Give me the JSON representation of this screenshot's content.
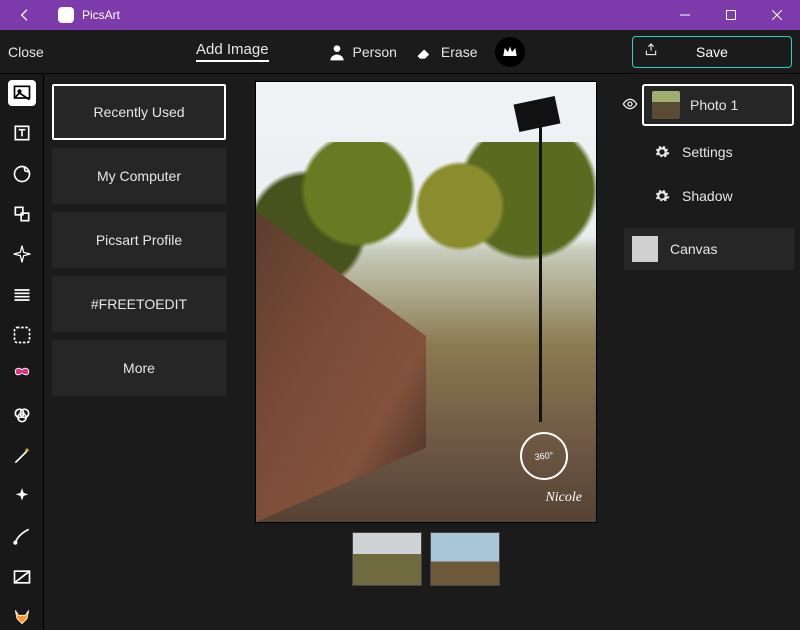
{
  "window": {
    "title": "PicsArt"
  },
  "topbar": {
    "close": "Close",
    "add_image": "Add Image",
    "person": "Person",
    "erase": "Erase",
    "save": "Save"
  },
  "sources": {
    "items": [
      "Recently Used",
      "My Computer",
      "Picsart Profile",
      "#FREETOEDIT",
      "More"
    ]
  },
  "canvas": {
    "badge": "360°",
    "signature": "Nicole"
  },
  "layers": {
    "photo1": "Photo 1",
    "settings": "Settings",
    "shadow": "Shadow",
    "canvas": "Canvas"
  },
  "icons": {
    "rail": [
      "image",
      "text",
      "sticker",
      "shapes",
      "spark",
      "lines",
      "frame",
      "butterfly",
      "color",
      "wand",
      "sparkle",
      "brush",
      "mask",
      "fox"
    ]
  }
}
